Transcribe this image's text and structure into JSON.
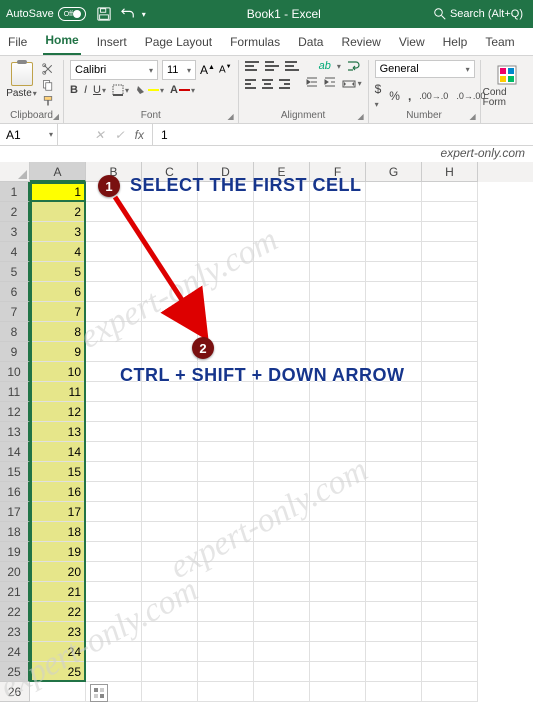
{
  "titlebar": {
    "autosave": "AutoSave",
    "autosave_state": "Off",
    "doc_title": "Book1 - Excel",
    "search_placeholder": "Search (Alt+Q)"
  },
  "tabs": {
    "file": "File",
    "home": "Home",
    "insert": "Insert",
    "page_layout": "Page Layout",
    "formulas": "Formulas",
    "data": "Data",
    "review": "Review",
    "view": "View",
    "help": "Help",
    "team": "Team"
  },
  "ribbon": {
    "clipboard": {
      "label": "Clipboard",
      "paste": "Paste"
    },
    "font": {
      "label": "Font",
      "name": "Calibri",
      "size": "11",
      "bold": "B",
      "italic": "I",
      "underline": "U"
    },
    "alignment": {
      "label": "Alignment"
    },
    "number": {
      "label": "Number",
      "format": "General",
      "currency": "$",
      "percent": "%",
      "comma": ","
    },
    "styles": {
      "cond": "Cond Form"
    }
  },
  "fxbar": {
    "namebox": "A1",
    "fx": "fx",
    "formula": "1"
  },
  "watermark": "expert-only.com",
  "columns": [
    "A",
    "B",
    "C",
    "D",
    "E",
    "F",
    "G",
    "H"
  ],
  "row_count": 26,
  "selected_values": [
    "1",
    "2",
    "3",
    "4",
    "5",
    "6",
    "7",
    "8",
    "9",
    "10",
    "11",
    "12",
    "13",
    "14",
    "15",
    "16",
    "17",
    "18",
    "19",
    "20",
    "21",
    "22",
    "23",
    "24",
    "25"
  ],
  "annotations": {
    "badge1": "1",
    "text1": "SELECT THE FIRST CELL",
    "badge2": "2",
    "text2": "CTRL + SHIFT + DOWN ARROW"
  }
}
